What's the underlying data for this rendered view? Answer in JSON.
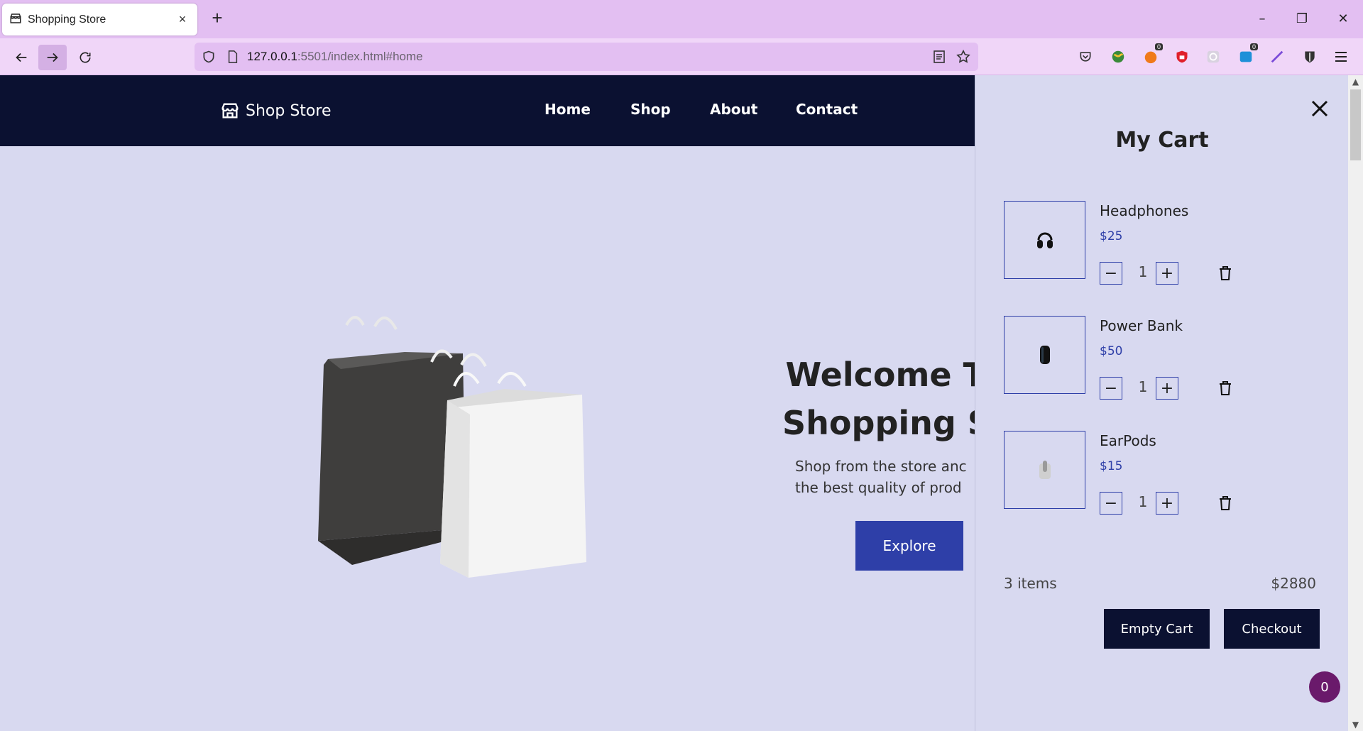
{
  "browser": {
    "tab_title": "Shopping Store",
    "tab_close": "×",
    "new_tab": "+",
    "url_host": "127.0.0.1",
    "url_rest": ":5501/index.html#home",
    "extension_badges": [
      "0",
      "0"
    ]
  },
  "site": {
    "logo_text": "Shop Store",
    "nav": [
      "Home",
      "Shop",
      "About",
      "Contact"
    ]
  },
  "hero": {
    "title": "Welcome To\nShopping St",
    "subtitle": "Shop from the store anc\nthe best quality of prod",
    "explore_label": "Explore"
  },
  "cart": {
    "title": "My Cart",
    "items": [
      {
        "name": "Headphones",
        "price": "$25",
        "qty": "1"
      },
      {
        "name": "Power Bank",
        "price": "$50",
        "qty": "1"
      },
      {
        "name": "EarPods",
        "price": "$15",
        "qty": "1"
      }
    ],
    "minus": "−",
    "plus": "+",
    "count_label": "3 items",
    "total": "$2880",
    "empty_label": "Empty Cart",
    "checkout_label": "Checkout",
    "fab_count": "0"
  },
  "colors": {
    "chrome": "#e3bff2",
    "header": "#0b1131",
    "accent": "#2e3fa8",
    "background": "#d8d9f0"
  }
}
